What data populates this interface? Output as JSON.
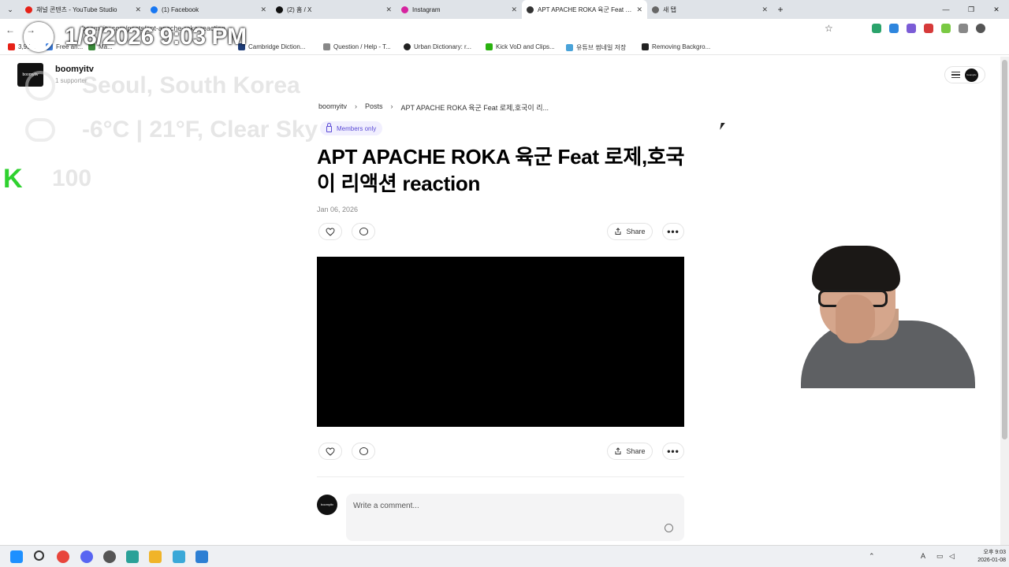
{
  "browser": {
    "tabs": [
      {
        "label": "채널 콘텐츠 - YouTube Studio",
        "color": "#e62117"
      },
      {
        "label": "(1) Facebook",
        "color": "#1877f2"
      },
      {
        "label": "(2) 홈 / X",
        "color": "#111111"
      },
      {
        "label": "Instagram",
        "color": "#d6249f"
      },
      {
        "label": "APT APACHE ROKA 육군 Feat 로제,호국이 리액션 reaction",
        "color": "#333333"
      },
      {
        "label": "새 탭",
        "color": "#666666"
      }
    ],
    "url": "boomyitv.com/posts/apt-apache-roka-reaction",
    "bookmarks": [
      {
        "label": "3,95...",
        "color": "#e62117"
      },
      {
        "label": "Free an...",
        "color": "#3b7ddd"
      },
      {
        "label": "Ma...",
        "color": "#3a8a3a"
      },
      {
        "label": "Cambridge Diction...",
        "color": "#1d3c78"
      },
      {
        "label": "Question / Help - T...",
        "color": "#888888"
      },
      {
        "label": "Urban Dictionary: r...",
        "color": "#222222"
      },
      {
        "label": "Kick VoD and Clips...",
        "color": "#2ab20f"
      },
      {
        "label": "유튜브 썸네일 저장",
        "color": "#49a3d9"
      },
      {
        "label": "Removing Backgro...",
        "color": "#222222"
      }
    ]
  },
  "overlay": {
    "datetime": "1/8/2026 9:03 PM",
    "location": "Seoul, South Korea",
    "weather": "-6°C | 21°F, Clear Sky",
    "score": "100"
  },
  "site": {
    "logo_text": "boomyitv",
    "brand": "boomyitv",
    "supporter": "1 supporter"
  },
  "breadcrumb": [
    "boomyitv",
    "Posts",
    "APT APACHE ROKA 육군 Feat 로제,호국이 리..."
  ],
  "post": {
    "badge": "Members only",
    "title": "APT APACHE ROKA 육군 Feat 로제,호국이 리액션 reaction",
    "date": "Jan 06, 2026",
    "share_label": "Share",
    "comment_placeholder": "Write a comment..."
  },
  "taskbar": {
    "ampm": "오후 9:03",
    "date": "2026-01-08"
  }
}
